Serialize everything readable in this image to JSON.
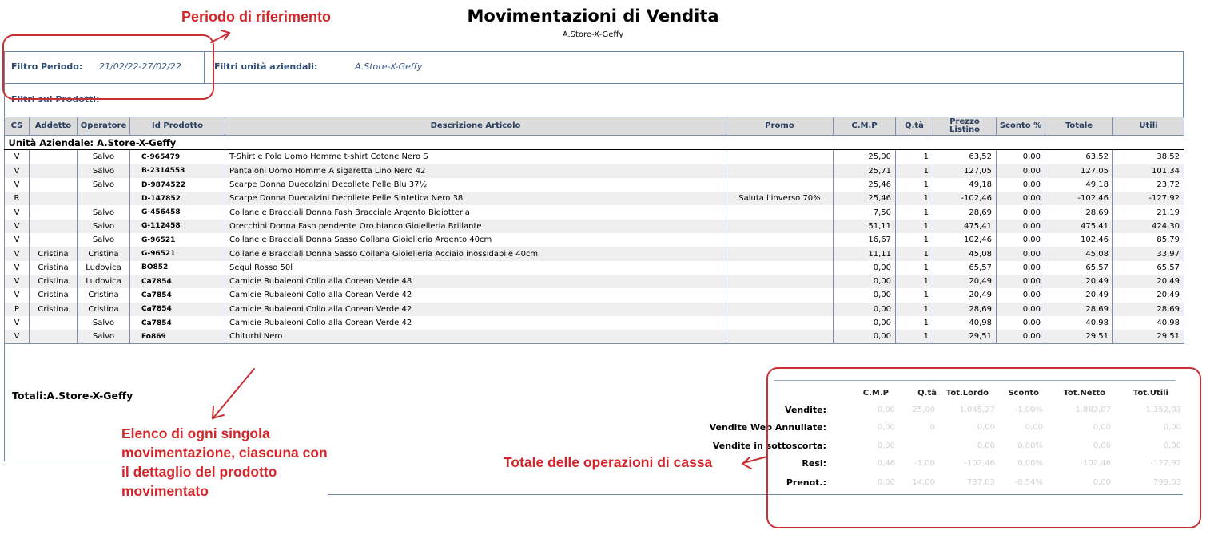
{
  "report": {
    "title": "Movimentazioni di Vendita",
    "subtitle": "A.Store-X-Geffy"
  },
  "filters": {
    "period_label": "Filtro Periodo:",
    "period_value": "21/02/22-27/02/22",
    "units_label": "Filtri unità aziendali:",
    "units_value": "A.Store-X-Geffy",
    "products_label": "Filtri sui Prodotti:"
  },
  "table": {
    "headers": [
      "CS",
      "Addetto",
      "Operatore",
      "Id Prodotto",
      "Descrizione Articolo",
      "Promo",
      "C.M.P",
      "Q.tà",
      "Prezzo Listino",
      "Sconto %",
      "Totale",
      "Utili"
    ],
    "unit_label": "Unità Aziendale: A.Store-X-Geffy",
    "rows": [
      {
        "cs": "V",
        "addetto": "",
        "operatore": "Salvo",
        "id": "C-965479",
        "descrizione": "T-Shirt e Polo Uomo Homme t-shirt Cotone Nero S",
        "promo": "",
        "cmp": "25,00",
        "qta": "1",
        "prezzo": "63,52",
        "sconto": "0,00",
        "totale": "63,52",
        "utili": "38,52"
      },
      {
        "cs": "V",
        "addetto": "",
        "operatore": "Salvo",
        "id": "B-2314553",
        "descrizione": "Pantaloni Uomo Homme A sigaretta Lino Nero 42",
        "promo": "",
        "cmp": "25,71",
        "qta": "1",
        "prezzo": "127,05",
        "sconto": "0,00",
        "totale": "127,05",
        "utili": "101,34"
      },
      {
        "cs": "V",
        "addetto": "",
        "operatore": "Salvo",
        "id": "D-9874522",
        "descrizione": "Scarpe Donna Duecalzini Decollete Pelle Blu 37½",
        "promo": "",
        "cmp": "25,46",
        "qta": "1",
        "prezzo": "49,18",
        "sconto": "0,00",
        "totale": "49,18",
        "utili": "23,72"
      },
      {
        "cs": "R",
        "addetto": "",
        "operatore": "",
        "id": "D-147852",
        "descrizione": "Scarpe Donna Duecalzini Decollete Pelle Sintetica Nero 38",
        "promo": "Saluta l'inverso 70%",
        "cmp": "25,46",
        "qta": "1",
        "prezzo": "-102,46",
        "sconto": "0,00",
        "totale": "-102,46",
        "utili": "-127,92"
      },
      {
        "cs": "V",
        "addetto": "",
        "operatore": "Salvo",
        "id": "G-456458",
        "descrizione": "Collane e Bracciali Donna Fash Bracciale Argento Bigiotteria",
        "promo": "",
        "cmp": "7,50",
        "qta": "1",
        "prezzo": "28,69",
        "sconto": "0,00",
        "totale": "28,69",
        "utili": "21,19"
      },
      {
        "cs": "V",
        "addetto": "",
        "operatore": "Salvo",
        "id": "G-112458",
        "descrizione": "Orecchini Donna Fash pendente Oro bianco Gioielleria Brillante",
        "promo": "",
        "cmp": "51,11",
        "qta": "1",
        "prezzo": "475,41",
        "sconto": "0,00",
        "totale": "475,41",
        "utili": "424,30"
      },
      {
        "cs": "V",
        "addetto": "",
        "operatore": "Salvo",
        "id": "G-96521",
        "descrizione": "Collane e Bracciali Donna Sasso Collana Gioielleria Argento 40cm",
        "promo": "",
        "cmp": "16,67",
        "qta": "1",
        "prezzo": "102,46",
        "sconto": "0,00",
        "totale": "102,46",
        "utili": "85,79"
      },
      {
        "cs": "V",
        "addetto": "Cristina",
        "operatore": "Cristina",
        "id": "G-96521",
        "descrizione": "Collane e Bracciali Donna Sasso Collana Gioielleria Acciaio inossidabile 40cm",
        "promo": "",
        "cmp": "11,11",
        "qta": "1",
        "prezzo": "45,08",
        "sconto": "0,00",
        "totale": "45,08",
        "utili": "33,97"
      },
      {
        "cs": "V",
        "addetto": "Cristina",
        "operatore": "Ludovica",
        "id": "BO852",
        "descrizione": "Segul Rosso 50l",
        "promo": "",
        "cmp": "0,00",
        "qta": "1",
        "prezzo": "65,57",
        "sconto": "0,00",
        "totale": "65,57",
        "utili": "65,57"
      },
      {
        "cs": "V",
        "addetto": "Cristina",
        "operatore": "Ludovica",
        "id": "Ca7854",
        "descrizione": "Camicie Rubaleoni Collo alla Corean Verde 48",
        "promo": "",
        "cmp": "0,00",
        "qta": "1",
        "prezzo": "20,49",
        "sconto": "0,00",
        "totale": "20,49",
        "utili": "20,49"
      },
      {
        "cs": "V",
        "addetto": "Cristina",
        "operatore": "Cristina",
        "id": "Ca7854",
        "descrizione": "Camicie Rubaleoni Collo alla Corean Verde 42",
        "promo": "",
        "cmp": "0,00",
        "qta": "1",
        "prezzo": "20,49",
        "sconto": "0,00",
        "totale": "20,49",
        "utili": "20,49"
      },
      {
        "cs": "P",
        "addetto": "Cristina",
        "operatore": "Cristina",
        "id": "Ca7854",
        "descrizione": "Camicie Rubaleoni Collo alla Corean Verde 42",
        "promo": "",
        "cmp": "0,00",
        "qta": "1",
        "prezzo": "28,69",
        "sconto": "0,00",
        "totale": "28,69",
        "utili": "28,69"
      },
      {
        "cs": "V",
        "addetto": "",
        "operatore": "Salvo",
        "id": "Ca7854",
        "descrizione": "Camicie Rubaleoni Collo alla Corean Verde 42",
        "promo": "",
        "cmp": "0,00",
        "qta": "1",
        "prezzo": "40,98",
        "sconto": "0,00",
        "totale": "40,98",
        "utili": "40,98"
      },
      {
        "cs": "V",
        "addetto": "",
        "operatore": "Salvo",
        "id": "Fo869",
        "descrizione": "Chiturbi Nero",
        "promo": "",
        "cmp": "0,00",
        "qta": "1",
        "prezzo": "29,51",
        "sconto": "0,00",
        "totale": "29,51",
        "utili": "29,51"
      }
    ]
  },
  "totals": {
    "label": "Totali:A.Store-X-Geffy",
    "headers": [
      "C.M.P",
      "Q.tà",
      "Tot.Lordo",
      "Sconto",
      "Tot.Netto",
      "Tot.Utili"
    ],
    "rows": [
      {
        "label": "Vendite:",
        "values": [
          "0,00",
          "25,00",
          "1.045,27",
          "-1,00%",
          "1.882,07",
          "1.352,03"
        ]
      },
      {
        "label": "Vendite Web Annullate:",
        "values": [
          "0,00",
          "0",
          "0,00",
          "0,00",
          "0,00",
          "0,00"
        ]
      },
      {
        "label": "Vendite in sottoscorta:",
        "values": [
          "0,00",
          "",
          "0,00",
          "0,00%",
          "0,00",
          "0,00"
        ]
      },
      {
        "label": "Resi:",
        "values": [
          "0,46",
          "-1,00",
          "-102,46",
          "0,00%",
          "-102,46",
          "-127,92"
        ]
      },
      {
        "label": "Prenot.:",
        "values": [
          "0,00",
          "14,00",
          "737,03",
          "-8,54%",
          "0,00",
          "799,03"
        ]
      }
    ]
  },
  "annotations": {
    "period_note": "Periodo di riferimento",
    "list_note": "Elenco di ogni singola movimentazione, ciascuna con il dettaglio del prodotto movimentato",
    "totals_note": "Totale delle operazioni di cassa"
  },
  "colors": {
    "annotation": "#d3262a",
    "border": "#6e86a6",
    "header_bg": "#dcdcdc"
  }
}
